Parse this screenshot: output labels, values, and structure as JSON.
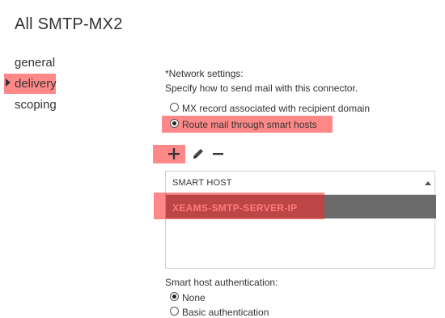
{
  "page": {
    "title": "All SMTP-MX2"
  },
  "nav": {
    "items": [
      {
        "label": "general"
      },
      {
        "label": "delivery"
      },
      {
        "label": "scoping"
      }
    ]
  },
  "network": {
    "heading": "*Network settings:",
    "description": "Specify how to send mail with this connector.",
    "options": [
      {
        "label": "MX record associated with recipient domain",
        "selected": false
      },
      {
        "label": "Route mail through smart hosts",
        "selected": true
      }
    ]
  },
  "toolbar": {
    "add_icon": "plus-icon",
    "edit_icon": "pencil-icon",
    "remove_icon": "minus-icon"
  },
  "smart_hosts": {
    "column_header": "SMART HOST",
    "rows": [
      {
        "value": "XEAMS-SMTP-SERVER-IP",
        "selected": true
      }
    ]
  },
  "auth": {
    "label": "Smart host authentication:",
    "options": [
      {
        "label": "None",
        "selected": true
      },
      {
        "label": "Basic authentication",
        "selected": false
      }
    ]
  },
  "colors": {
    "highlight": "#ff2828",
    "selected_row": "#6b6b6b",
    "selected_row_text": "#ff7a7a"
  }
}
